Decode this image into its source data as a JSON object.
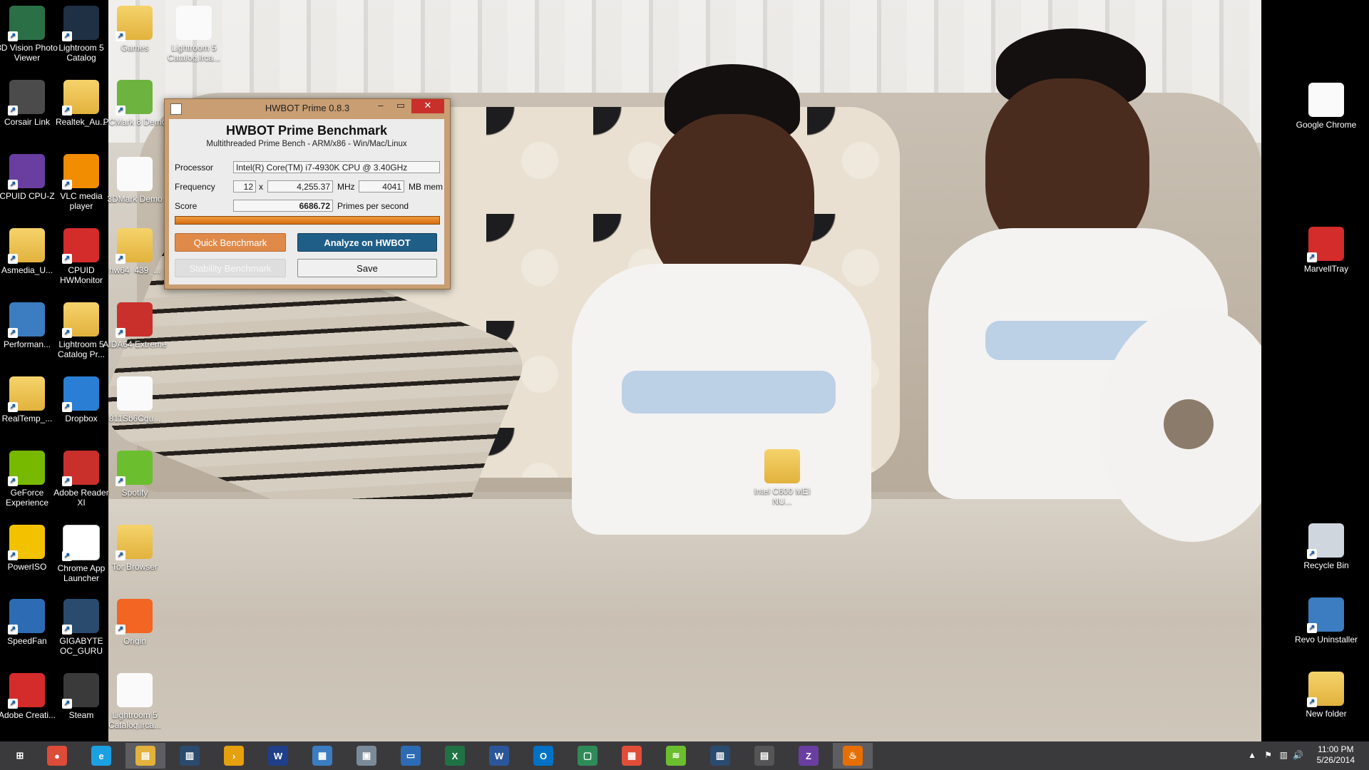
{
  "desktop": {
    "left_icons": [
      {
        "label": "3D Vision Photo Viewer",
        "icon": "3d-vision-icon",
        "color": "#2b6f46"
      },
      {
        "label": "Lightroom 5 Catalog",
        "icon": "lightroom-icon",
        "color": "#1f2f44"
      },
      {
        "label": "Corsair Link",
        "icon": "corsair-icon",
        "color": "#4b4b4b"
      },
      {
        "label": "Realtek_Au...",
        "icon": "folder-icon",
        "color": "#e2b23d"
      },
      {
        "label": "CPUID CPU-Z",
        "icon": "cpuz-icon",
        "color": "#6a3ea1"
      },
      {
        "label": "VLC media player",
        "icon": "vlc-icon",
        "color": "#f28c00"
      },
      {
        "label": "Asmedia_U...",
        "icon": "folder-icon",
        "color": "#e2b23d"
      },
      {
        "label": "CPUID HWMonitor",
        "icon": "hwmonitor-icon",
        "color": "#d42b2b"
      },
      {
        "label": "Performan...",
        "icon": "performance-icon",
        "color": "#3b7dc0"
      },
      {
        "label": "Lightroom 5 Catalog Pr...",
        "icon": "folder-icon",
        "color": "#e2b23d"
      },
      {
        "label": "RealTemp_...",
        "icon": "folder-icon",
        "color": "#e2b23d"
      },
      {
        "label": "Dropbox",
        "icon": "dropbox-icon",
        "color": "#2a7fd4"
      },
      {
        "label": "GeForce Experience",
        "icon": "geforce-icon",
        "color": "#76b900"
      },
      {
        "label": "Adobe Reader XI",
        "icon": "adobe-reader-icon",
        "color": "#c9302c"
      },
      {
        "label": "PowerISO",
        "icon": "poweriso-icon",
        "color": "#f2c200"
      },
      {
        "label": "Chrome App Launcher",
        "icon": "app-launcher-icon",
        "color": "#ffffff"
      },
      {
        "label": "SpeedFan",
        "icon": "speedfan-icon",
        "color": "#2d6cb5"
      },
      {
        "label": "GIGABYTE OC_GURU",
        "icon": "gigabyte-icon",
        "color": "#2a4b6e"
      },
      {
        "label": "Adobe Creati...",
        "icon": "adobe-cc-icon",
        "color": "#d42b2b"
      },
      {
        "label": "Steam",
        "icon": "steam-icon",
        "color": "#3a3a3a"
      }
    ],
    "middle_icons": [
      {
        "label": "Games",
        "icon": "folder-icon",
        "color": "#e2b23d"
      },
      {
        "label": "Lightroom 5 Catalog.lrca...",
        "icon": "file-icon",
        "color": "#fafafa"
      },
      {
        "label": "PCMark 8 Demo",
        "icon": "pcmark-icon",
        "color": "#6cb33f"
      },
      {
        "label": "3DMark Demo",
        "icon": "file-icon",
        "color": "#fafafa"
      },
      {
        "label": "hw64_439_...",
        "icon": "folder-icon",
        "color": "#e2b23d"
      },
      {
        "label": "AIDA64 Extreme",
        "icon": "aida64-icon",
        "color": "#c9302c"
      },
      {
        "label": "811Sb6Cgu...",
        "icon": "image-file-icon",
        "color": "#fafafa"
      },
      {
        "label": "Spotify",
        "icon": "spotify-icon",
        "color": "#6bbf2f"
      },
      {
        "label": "Tor Browser",
        "icon": "folder-icon",
        "color": "#e2b23d"
      },
      {
        "label": "Origin",
        "icon": "origin-icon",
        "color": "#f26522"
      },
      {
        "label": "Lightroom 5 Catalog.lrca...",
        "icon": "file-icon",
        "color": "#fafafa"
      }
    ],
    "center_icon": {
      "label": "Intel C600 MEI NU...",
      "icon": "folder-icon",
      "color": "#e2b23d"
    },
    "right_icons": [
      {
        "label": "Google Chrome",
        "icon": "file-icon",
        "color": "#fafafa"
      },
      {
        "label": "MarvellTray",
        "icon": "marvell-icon",
        "color": "#d42b2b"
      },
      {
        "label": "Recycle Bin",
        "icon": "recycle-bin-icon",
        "color": "#cfd6de"
      },
      {
        "label": "Revo Uninstaller",
        "icon": "revo-icon",
        "color": "#3b7dc0"
      },
      {
        "label": "New folder",
        "icon": "folder-icon",
        "color": "#e2b23d"
      }
    ]
  },
  "hwbot": {
    "window_title": "HWBOT Prime 0.8.3",
    "heading": "HWBOT Prime Benchmark",
    "subheading": "Multithreaded Prime Bench - ARM/x86 - Win/Mac/Linux",
    "labels": {
      "processor": "Processor",
      "frequency": "Frequency",
      "score": "Score"
    },
    "processor": "Intel(R) Core(TM) i7-4930K CPU @ 3.40GHz",
    "multiplier": "12",
    "x_sep": "x",
    "frequency_value": "4,255.37",
    "freq_unit": "MHz",
    "memory": "4041",
    "mem_unit": "MB mem",
    "score": "6686.72",
    "score_unit": "Primes per second",
    "progress": 1.0,
    "buttons": {
      "quick": "Quick Benchmark",
      "analyze": "Analyze on HWBOT",
      "stability": "Stability Benchmark",
      "save": "Save"
    },
    "controls": {
      "min": "–",
      "max": "▭",
      "close": "✕"
    }
  },
  "taskbar": {
    "items": [
      {
        "name": "start",
        "glyph": "⊞",
        "color": "#3a3a3d"
      },
      {
        "name": "chrome",
        "glyph": "●",
        "color": "#dd4b39"
      },
      {
        "name": "internet-explorer",
        "glyph": "e",
        "color": "#1ba1e2"
      },
      {
        "name": "file-explorer",
        "glyph": "▤",
        "color": "#e2b23d"
      },
      {
        "name": "hwmonitor-bars",
        "glyph": "▥",
        "color": "#2a4b6e"
      },
      {
        "name": "plex",
        "glyph": "›",
        "color": "#e5a00d"
      },
      {
        "name": "weather-channel",
        "glyph": "W",
        "color": "#1f3f8a"
      },
      {
        "name": "control-panel",
        "glyph": "▦",
        "color": "#3b7dc0"
      },
      {
        "name": "photo-gallery",
        "glyph": "▣",
        "color": "#7a8a99"
      },
      {
        "name": "remote-desktop",
        "glyph": "▭",
        "color": "#2d6cb5"
      },
      {
        "name": "excel",
        "glyph": "X",
        "color": "#1f7244"
      },
      {
        "name": "word",
        "glyph": "W",
        "color": "#2b579a"
      },
      {
        "name": "outlook",
        "glyph": "O",
        "color": "#0072c6"
      },
      {
        "name": "store",
        "glyph": "▢",
        "color": "#2e8b57"
      },
      {
        "name": "app-launcher",
        "glyph": "▦",
        "color": "#e04e39"
      },
      {
        "name": "spotify",
        "glyph": "≋",
        "color": "#6bbf2f"
      },
      {
        "name": "hwbot-bars",
        "glyph": "▥",
        "color": "#2a4b6e"
      },
      {
        "name": "file-manager",
        "glyph": "▤",
        "color": "#555"
      },
      {
        "name": "cpuz",
        "glyph": "Z",
        "color": "#6a3ea1"
      },
      {
        "name": "java",
        "glyph": "♨",
        "color": "#e76f00"
      }
    ],
    "clock_time": "11:00 PM",
    "clock_date": "5/26/2014",
    "tray": {
      "chevron": "▲",
      "flag": "⚑",
      "network": "▥",
      "volume": "🔊"
    }
  }
}
